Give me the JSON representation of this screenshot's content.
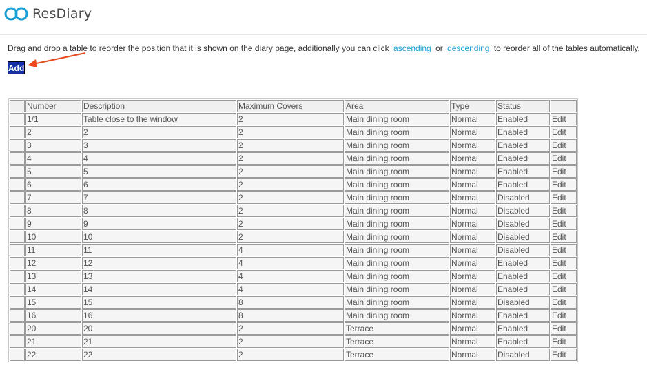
{
  "app": {
    "brand": "ResDiary"
  },
  "intro": {
    "before": "Drag and drop a table to reorder the position that it is shown on the diary page, additionally you can click",
    "ascending": "ascending",
    "or": "or",
    "descending": "descending",
    "after": "to reorder all of the tables automatically."
  },
  "toolbar": {
    "add_label": "Add"
  },
  "table": {
    "headers": [
      "",
      "Number",
      "Description",
      "Maximum Covers",
      "Area",
      "Type",
      "Status",
      ""
    ],
    "edit_label": "Edit",
    "rows": [
      {
        "number": "1/1",
        "description": "Table close to the window",
        "covers": "2",
        "area": "Main dining room",
        "type": "Normal",
        "status": "Enabled"
      },
      {
        "number": "2",
        "description": "2",
        "covers": "2",
        "area": "Main dining room",
        "type": "Normal",
        "status": "Enabled"
      },
      {
        "number": "3",
        "description": "3",
        "covers": "2",
        "area": "Main dining room",
        "type": "Normal",
        "status": "Enabled"
      },
      {
        "number": "4",
        "description": "4",
        "covers": "2",
        "area": "Main dining room",
        "type": "Normal",
        "status": "Enabled"
      },
      {
        "number": "5",
        "description": "5",
        "covers": "2",
        "area": "Main dining room",
        "type": "Normal",
        "status": "Enabled"
      },
      {
        "number": "6",
        "description": "6",
        "covers": "2",
        "area": "Main dining room",
        "type": "Normal",
        "status": "Enabled"
      },
      {
        "number": "7",
        "description": "7",
        "covers": "2",
        "area": "Main dining room",
        "type": "Normal",
        "status": "Disabled"
      },
      {
        "number": "8",
        "description": "8",
        "covers": "2",
        "area": "Main dining room",
        "type": "Normal",
        "status": "Disabled"
      },
      {
        "number": "9",
        "description": "9",
        "covers": "2",
        "area": "Main dining room",
        "type": "Normal",
        "status": "Disabled"
      },
      {
        "number": "10",
        "description": "10",
        "covers": "2",
        "area": "Main dining room",
        "type": "Normal",
        "status": "Disabled"
      },
      {
        "number": "11",
        "description": "11",
        "covers": "4",
        "area": "Main dining room",
        "type": "Normal",
        "status": "Disabled"
      },
      {
        "number": "12",
        "description": "12",
        "covers": "4",
        "area": "Main dining room",
        "type": "Normal",
        "status": "Enabled"
      },
      {
        "number": "13",
        "description": "13",
        "covers": "4",
        "area": "Main dining room",
        "type": "Normal",
        "status": "Enabled"
      },
      {
        "number": "14",
        "description": "14",
        "covers": "4",
        "area": "Main dining room",
        "type": "Normal",
        "status": "Enabled"
      },
      {
        "number": "15",
        "description": "15",
        "covers": "8",
        "area": "Main dining room",
        "type": "Normal",
        "status": "Disabled"
      },
      {
        "number": "16",
        "description": "16",
        "covers": "8",
        "area": "Main dining room",
        "type": "Normal",
        "status": "Enabled"
      },
      {
        "number": "20",
        "description": "20",
        "covers": "2",
        "area": "Terrace",
        "type": "Normal",
        "status": "Enabled"
      },
      {
        "number": "21",
        "description": "21",
        "covers": "2",
        "area": "Terrace",
        "type": "Normal",
        "status": "Enabled"
      },
      {
        "number": "22",
        "description": "22",
        "covers": "2",
        "area": "Terrace",
        "type": "Normal",
        "status": "Disabled"
      }
    ]
  },
  "colors": {
    "link": "#1a9fd6",
    "add_button": "#1531a7",
    "arrow": "#e8481c",
    "logo": "#1a9fd6"
  }
}
